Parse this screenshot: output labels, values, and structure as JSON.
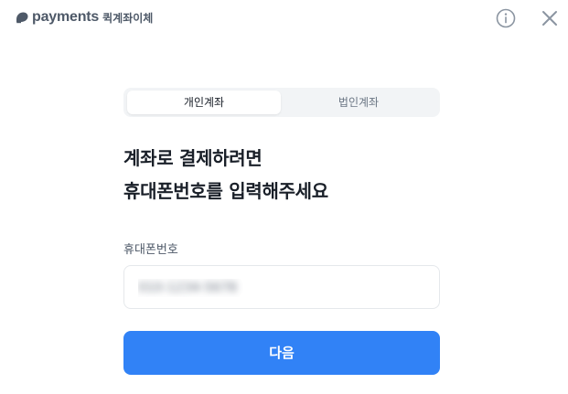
{
  "header": {
    "brand_name": "payments",
    "service_name": "퀵계좌이체",
    "info_icon": "info-circle-icon",
    "close_icon": "close-x-icon"
  },
  "tabs": [
    {
      "label": "개인계좌",
      "selected": true
    },
    {
      "label": "법인계좌",
      "selected": false
    }
  ],
  "title": {
    "line1": "계좌로 결제하려면",
    "line2": "휴대폰번호를 입력해주세요"
  },
  "phone_field": {
    "label": "휴대폰번호",
    "value": "010-1234-5678"
  },
  "next_button": {
    "label": "다음"
  },
  "colors": {
    "accent": "#3182f6",
    "text_primary": "#191f28",
    "text_secondary": "#4e5968",
    "segment_bg": "#f2f4f6"
  }
}
